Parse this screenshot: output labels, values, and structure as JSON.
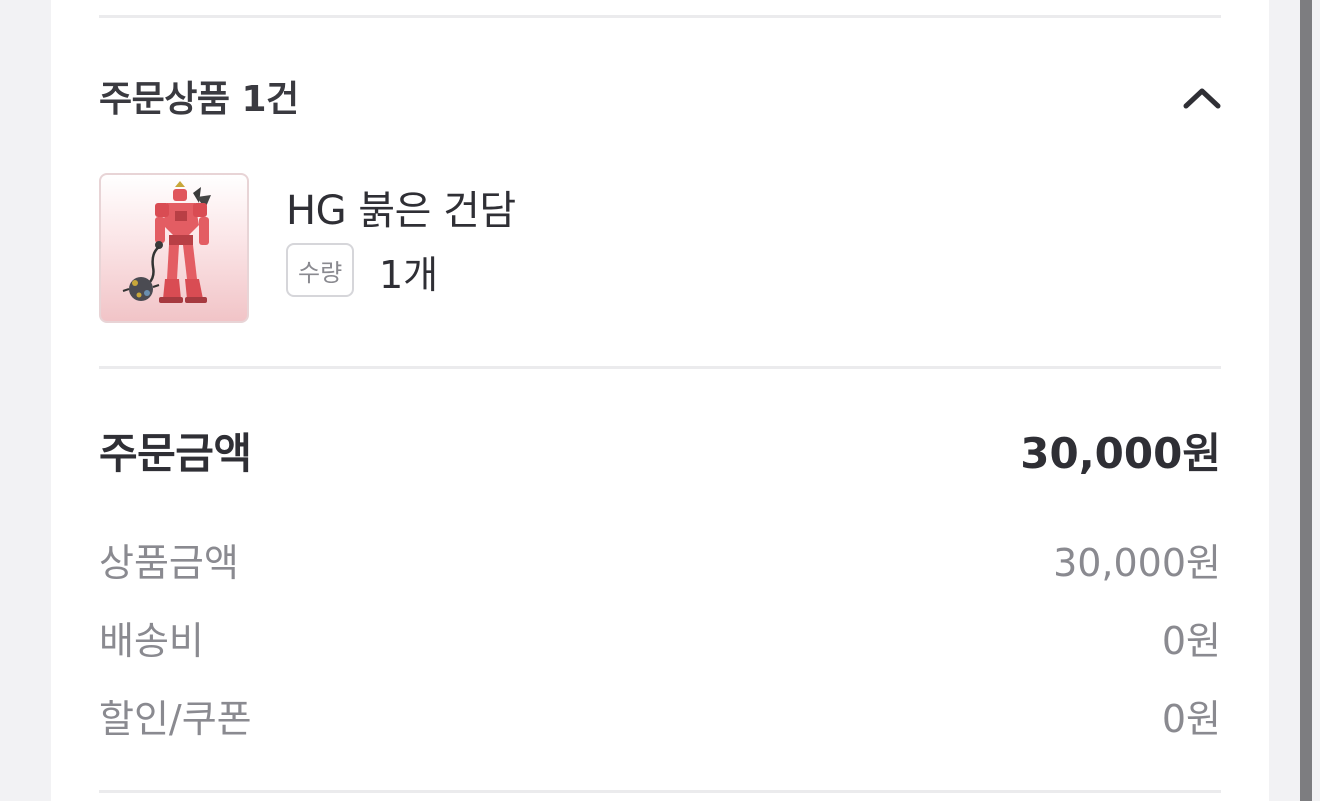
{
  "order_items": {
    "title": "주문상품 1건",
    "toggle_icon": "chevron-up-icon",
    "items": [
      {
        "thumbnail": "red-gundam-figure",
        "name": "HG 붉은 건담",
        "qty_label": "수량",
        "qty_value": "1개"
      }
    ]
  },
  "summary": {
    "total_label": "주문금액",
    "total_value": "30,000원",
    "rows": [
      {
        "label": "상품금액",
        "value": "30,000원"
      },
      {
        "label": "배송비",
        "value": "0원"
      },
      {
        "label": "할인/쿠폰",
        "value": "0원"
      }
    ]
  },
  "colors": {
    "text_primary": "#2f2f35",
    "text_secondary": "#8a8a90",
    "divider": "#ebebed",
    "background": "#f2f2f4",
    "thumb_accent": "#e06a6f"
  }
}
